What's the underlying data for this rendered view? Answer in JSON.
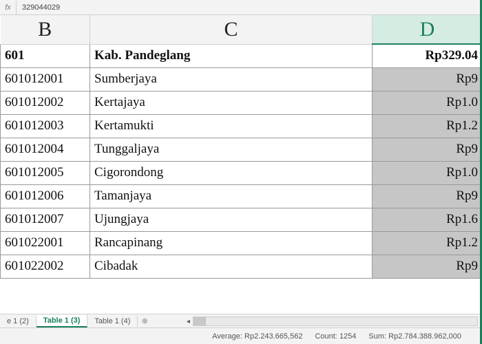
{
  "formula_bar": {
    "fx_label": "fx",
    "value": "329044029"
  },
  "columns": {
    "b": "B",
    "c": "C",
    "d": "D"
  },
  "header_row": {
    "code": "601",
    "name": "Kab. Pandeglang",
    "amount": "Rp329.04"
  },
  "rows": [
    {
      "code": "601012001",
      "name": "Sumberjaya",
      "amount": "Rp9"
    },
    {
      "code": "601012002",
      "name": "Kertajaya",
      "amount": "Rp1.0"
    },
    {
      "code": "601012003",
      "name": "Kertamukti",
      "amount": "Rp1.2"
    },
    {
      "code": "601012004",
      "name": "Tunggaljaya",
      "amount": "Rp9"
    },
    {
      "code": "601012005",
      "name": "Cigorondong",
      "amount": "Rp1.0"
    },
    {
      "code": "601012006",
      "name": "Tamanjaya",
      "amount": "Rp9"
    },
    {
      "code": "601012007",
      "name": "Ujungjaya",
      "amount": "Rp1.6"
    },
    {
      "code": "601022001",
      "name": "Rancapinang",
      "amount": "Rp1.2"
    },
    {
      "code": "601022002",
      "name": "Cibadak",
      "amount": "Rp9"
    }
  ],
  "tabs": {
    "items": [
      {
        "label": "e 1 (2)",
        "active": false
      },
      {
        "label": "Table 1 (3)",
        "active": true
      },
      {
        "label": "Table 1 (4)",
        "active": false
      }
    ],
    "add": "⊕"
  },
  "status": {
    "average_label": "Average:",
    "average": "Rp2.243.665,562",
    "count_label": "Count:",
    "count": "1254",
    "sum_label": "Sum:",
    "sum": "Rp2.784.388.962,000"
  }
}
